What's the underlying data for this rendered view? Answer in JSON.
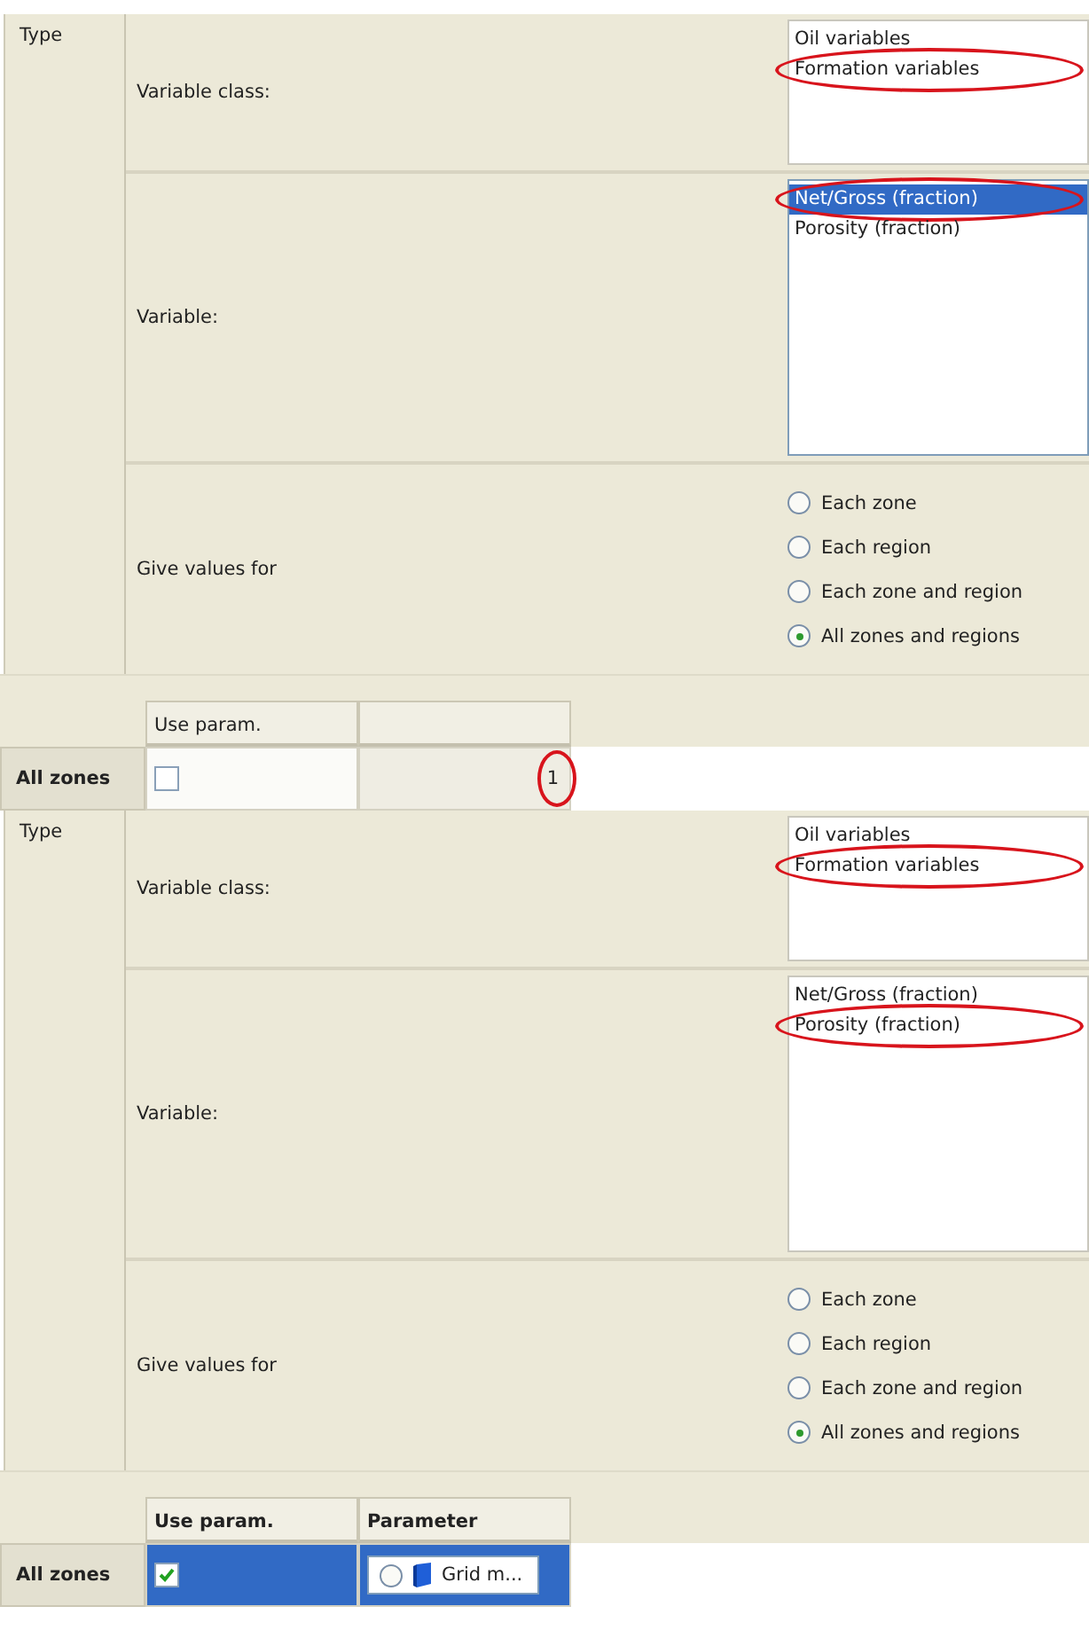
{
  "panels": [
    {
      "type_label": "Type",
      "rows": [
        {
          "kind": "list",
          "label": "Variable class:",
          "items": [
            {
              "text": "Oil variables",
              "selected": false,
              "circled": false
            },
            {
              "text": "Formation variables",
              "selected": false,
              "circled": true
            }
          ]
        },
        {
          "kind": "list",
          "label": "Variable:",
          "focused": true,
          "items": [
            {
              "text": "Net/Gross (fraction)",
              "selected": true,
              "circled": true
            },
            {
              "text": "Porosity (fraction)",
              "selected": false,
              "circled": false
            }
          ]
        },
        {
          "kind": "radios",
          "label": "Give values for",
          "options": [
            {
              "text": "Each zone",
              "selected": false
            },
            {
              "text": "Each region",
              "selected": false
            },
            {
              "text": "Each zone and region",
              "selected": false
            },
            {
              "text": "All zones and regions",
              "selected": true
            }
          ]
        }
      ],
      "table": {
        "bold_headers": false,
        "columns": [
          {
            "label": "Use param."
          },
          {
            "kind": "blank"
          }
        ],
        "row": {
          "label": "All zones",
          "checked": false,
          "selected": false,
          "cell": {
            "kind": "text",
            "text": "1",
            "circled": true
          }
        }
      }
    },
    {
      "type_label": "Type",
      "rows": [
        {
          "kind": "list",
          "label": "Variable class:",
          "items": [
            {
              "text": "Oil variables",
              "selected": false,
              "circled": false
            },
            {
              "text": "Formation variables",
              "selected": false,
              "circled": true
            }
          ]
        },
        {
          "kind": "list",
          "label": "Variable:",
          "focused": false,
          "items": [
            {
              "text": "Net/Gross (fraction)",
              "selected": false,
              "circled": false
            },
            {
              "text": "Porosity (fraction)",
              "selected": false,
              "circled": true
            }
          ]
        },
        {
          "kind": "radios",
          "label": "Give values for",
          "options": [
            {
              "text": "Each zone",
              "selected": false
            },
            {
              "text": "Each region",
              "selected": false
            },
            {
              "text": "Each zone and region",
              "selected": false
            },
            {
              "text": "All zones and regions",
              "selected": true
            }
          ]
        }
      ],
      "table": {
        "bold_headers": true,
        "columns": [
          {
            "label": "Use param."
          },
          {
            "label": "Parameter"
          }
        ],
        "row": {
          "label": "All zones",
          "checked": true,
          "selected": true,
          "cell": {
            "kind": "parameter",
            "text": "Grid m...",
            "selected": false
          }
        }
      }
    }
  ]
}
